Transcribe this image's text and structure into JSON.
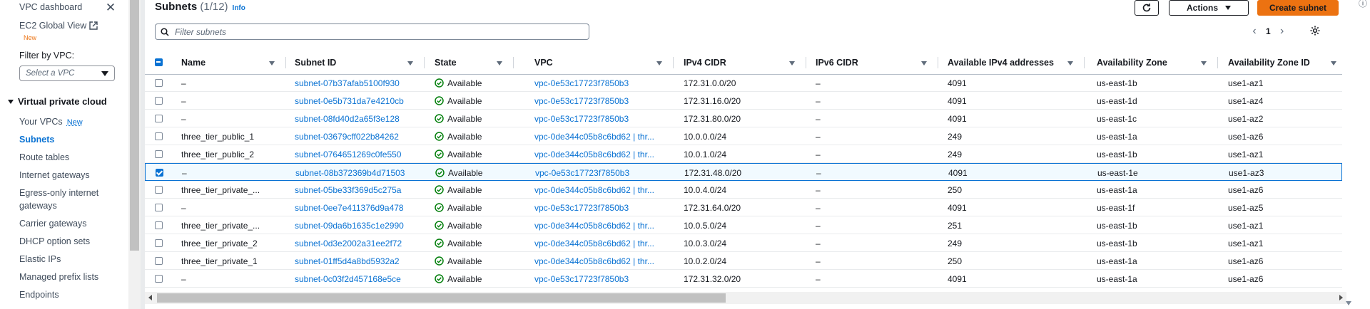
{
  "sidebar": {
    "top_items": [
      {
        "label": "VPC dashboard"
      },
      {
        "label": "EC2 Global View",
        "badge": "New"
      }
    ],
    "filter_label": "Filter by VPC:",
    "filter_placeholder": "Select a VPC",
    "section_title": "Virtual private cloud",
    "items": [
      {
        "label": "Your VPCs",
        "new_link": "New"
      },
      {
        "label": "Subnets",
        "active": true
      },
      {
        "label": "Route tables"
      },
      {
        "label": "Internet gateways"
      },
      {
        "label": "Egress-only internet"
      },
      {
        "label": "gateways"
      },
      {
        "label": "Carrier gateways"
      },
      {
        "label": "DHCP option sets"
      },
      {
        "label": "Elastic IPs"
      },
      {
        "label": "Managed prefix lists"
      },
      {
        "label": "Endpoints"
      }
    ]
  },
  "header": {
    "title": "Subnets",
    "count": "(1/12)",
    "info_link": "Info",
    "actions_label": "Actions",
    "create_label": "Create subnet"
  },
  "search": {
    "placeholder": "Filter subnets"
  },
  "pager": {
    "page": "1"
  },
  "colors": {
    "accent": "#0972d3",
    "primary_button": "#ec7211",
    "status_ok": "#037f0c"
  },
  "table": {
    "columns": [
      "Name",
      "Subnet ID",
      "State",
      "VPC",
      "IPv4 CIDR",
      "IPv6 CIDR",
      "Available IPv4 addresses",
      "Availability Zone",
      "Availability Zone ID"
    ],
    "rows": [
      {
        "name": "–",
        "subnet_id": "subnet-07b37afab5100f930",
        "state": "Available",
        "vpc": "vpc-0e53c17723f7850b3",
        "ipv4": "172.31.0.0/20",
        "ipv6": "–",
        "avail": "4091",
        "az": "us-east-1b",
        "azid": "use1-az1",
        "selected": false
      },
      {
        "name": "–",
        "subnet_id": "subnet-0e5b731da7e4210cb",
        "state": "Available",
        "vpc": "vpc-0e53c17723f7850b3",
        "ipv4": "172.31.16.0/20",
        "ipv6": "–",
        "avail": "4091",
        "az": "us-east-1d",
        "azid": "use1-az4",
        "selected": false
      },
      {
        "name": "–",
        "subnet_id": "subnet-08fd40d2a65f3e128",
        "state": "Available",
        "vpc": "vpc-0e53c17723f7850b3",
        "ipv4": "172.31.80.0/20",
        "ipv6": "–",
        "avail": "4091",
        "az": "us-east-1c",
        "azid": "use1-az2",
        "selected": false
      },
      {
        "name": "three_tier_public_1",
        "subnet_id": "subnet-03679cff022b84262",
        "state": "Available",
        "vpc": "vpc-0de344c05b8c6bd62 | thr...",
        "ipv4": "10.0.0.0/24",
        "ipv6": "–",
        "avail": "249",
        "az": "us-east-1a",
        "azid": "use1-az6",
        "selected": false
      },
      {
        "name": "three_tier_public_2",
        "subnet_id": "subnet-0764651269c0fe550",
        "state": "Available",
        "vpc": "vpc-0de344c05b8c6bd62 | thr...",
        "ipv4": "10.0.1.0/24",
        "ipv6": "–",
        "avail": "249",
        "az": "us-east-1b",
        "azid": "use1-az1",
        "selected": false
      },
      {
        "name": "–",
        "subnet_id": "subnet-08b372369b4d71503",
        "state": "Available",
        "vpc": "vpc-0e53c17723f7850b3",
        "ipv4": "172.31.48.0/20",
        "ipv6": "–",
        "avail": "4091",
        "az": "us-east-1e",
        "azid": "use1-az3",
        "selected": true
      },
      {
        "name": "three_tier_private_...",
        "subnet_id": "subnet-05be33f369d5c275a",
        "state": "Available",
        "vpc": "vpc-0de344c05b8c6bd62 | thr...",
        "ipv4": "10.0.4.0/24",
        "ipv6": "–",
        "avail": "250",
        "az": "us-east-1a",
        "azid": "use1-az6",
        "selected": false
      },
      {
        "name": "–",
        "subnet_id": "subnet-0ee7e411376d9a478",
        "state": "Available",
        "vpc": "vpc-0e53c17723f7850b3",
        "ipv4": "172.31.64.0/20",
        "ipv6": "–",
        "avail": "4091",
        "az": "us-east-1f",
        "azid": "use1-az5",
        "selected": false
      },
      {
        "name": "three_tier_private_...",
        "subnet_id": "subnet-09da6b1635c1e2990",
        "state": "Available",
        "vpc": "vpc-0de344c05b8c6bd62 | thr...",
        "ipv4": "10.0.5.0/24",
        "ipv6": "–",
        "avail": "251",
        "az": "us-east-1b",
        "azid": "use1-az1",
        "selected": false
      },
      {
        "name": "three_tier_private_2",
        "subnet_id": "subnet-0d3e2002a31ee2f72",
        "state": "Available",
        "vpc": "vpc-0de344c05b8c6bd62 | thr...",
        "ipv4": "10.0.3.0/24",
        "ipv6": "–",
        "avail": "249",
        "az": "us-east-1b",
        "azid": "use1-az1",
        "selected": false
      },
      {
        "name": "three_tier_private_1",
        "subnet_id": "subnet-01ff5d4a8bd5932a2",
        "state": "Available",
        "vpc": "vpc-0de344c05b8c6bd62 | thr...",
        "ipv4": "10.0.2.0/24",
        "ipv6": "–",
        "avail": "250",
        "az": "us-east-1a",
        "azid": "use1-az6",
        "selected": false
      },
      {
        "name": "–",
        "subnet_id": "subnet-0c03f2d457168e5ce",
        "state": "Available",
        "vpc": "vpc-0e53c17723f7850b3",
        "ipv4": "172.31.32.0/20",
        "ipv6": "–",
        "avail": "4091",
        "az": "us-east-1a",
        "azid": "use1-az6",
        "selected": false
      }
    ]
  }
}
